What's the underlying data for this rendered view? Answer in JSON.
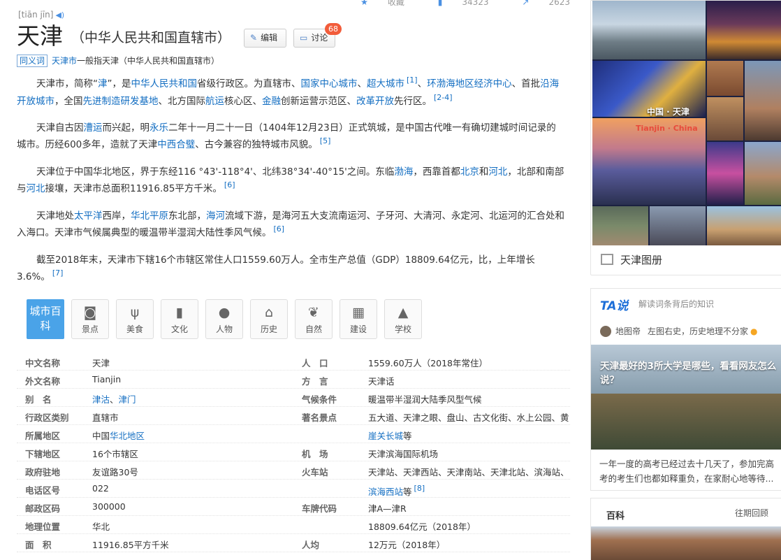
{
  "header": {
    "pinyin": "[tiān jīn]",
    "stats": {
      "collect": "收藏",
      "likes": "34323",
      "shares": "2623"
    }
  },
  "title": {
    "main": "天津",
    "sub": "（中华人民共和国直辖市）",
    "edit_label": "编辑",
    "discuss_label": "讨论",
    "discuss_count": "68"
  },
  "synonym": {
    "tag": "同义词",
    "term": "天津市",
    "text": "一般指天津（中华人民共和国直辖市）"
  },
  "paragraphs": {
    "p1": {
      "t1": "天津市，简称“",
      "l1": "津",
      "t2": "”，是",
      "l2": "中华人民共和国",
      "t3": "省级行政区。为直辖市、",
      "l3": "国家中心城市",
      "t4": "、",
      "l4": "超大城市",
      "ref1": "[1]",
      "t5": "、",
      "l5": "环渤海地区经济中心",
      "t6": "、首批",
      "l6": "沿海开放城市",
      "t7": "，全国",
      "l7": "先进制造研发基地",
      "t8": "、北方国际",
      "l8": "航运",
      "t9": "核心区、",
      "l9": "金融",
      "t10": "创新运营示范区、",
      "l10": "改革开放",
      "t11": "先行区。",
      "ref2": "[2-4]"
    },
    "p2": {
      "t1": "天津自古因",
      "l1": "漕运",
      "t2": "而兴起，明",
      "l2": "永乐",
      "t3": "二年十一月二十一日（1404年12月23日）正式筑城，是中国古代唯一有确切建城时间记录的城市。历经600多年，造就了天津",
      "l3": "中西合璧",
      "t4": "、古今兼容的独特城市风貌。",
      "ref": "[5]"
    },
    "p3": {
      "t1": "天津位于中国华北地区，界于东经116 °43'-118°4'、北纬38°34'-40°15'之间。东临",
      "l1": "渤海",
      "t2": "，西靠首都",
      "l2": "北京",
      "t3": "和",
      "l3": "河北",
      "t4": "，北部和南部与",
      "l4": "河北",
      "t5": "接壤，天津市总面积11916.85平方千米。",
      "ref": "[6]"
    },
    "p4": {
      "t1": "天津地处",
      "l1": "太平洋",
      "t2": "西岸，",
      "l2": "华北平原",
      "t3": "东北部，",
      "l3": "海河",
      "t4": "流域下游，是海河五大支流南运河、子牙河、大清河、永定河、北运河的汇合处和入海口。天津市气候属典型的暖温带半湿润大陆性季风气候。",
      "ref": "[6]"
    },
    "p5": {
      "t1": "截至2018年末，天津市下辖16个市辖区常住人口1559.60万人。全市生产总值（GDP）18809.64亿元，比，上年增长3.6%。",
      "ref": "[7]"
    }
  },
  "category_nav": {
    "first": "城市百科",
    "items": [
      {
        "label": "景点",
        "icon": "camera-icon"
      },
      {
        "label": "美食",
        "icon": "fork-knife-icon"
      },
      {
        "label": "文化",
        "icon": "book-icon"
      },
      {
        "label": "人物",
        "icon": "person-icon"
      },
      {
        "label": "历史",
        "icon": "temple-icon"
      },
      {
        "label": "自然",
        "icon": "leaf-icon"
      },
      {
        "label": "建设",
        "icon": "building-icon"
      },
      {
        "label": "学校",
        "icon": "graduation-cap-icon"
      }
    ]
  },
  "info": {
    "left": [
      {
        "k": "中文名称",
        "v": "天津"
      },
      {
        "k": "外文名称",
        "v": "Tianjin"
      },
      {
        "k": "别　名",
        "v1": "津沽",
        "sep": "、",
        "v2": "津门"
      },
      {
        "k": "行政区类别",
        "v": "直辖市"
      },
      {
        "k": "所属地区",
        "v_pre": "中国",
        "v_link": "华北地区"
      },
      {
        "k": "下辖地区",
        "v": "16个市辖区"
      },
      {
        "k": "政府驻地",
        "v": "友谊路30号"
      },
      {
        "k": "电话区号",
        "v": "022"
      },
      {
        "k": "邮政区码",
        "v": "300000"
      },
      {
        "k": "地理位置",
        "v": "华北"
      },
      {
        "k": "面　积",
        "v": "11916.85平方千米"
      }
    ],
    "right": [
      {
        "k": "人　口",
        "v": "1559.60万人（2018年常住）"
      },
      {
        "k": "方　言",
        "v": "天津话"
      },
      {
        "k": "气候条件",
        "v": "暖温带半湿润大陆季风型气候"
      },
      {
        "k": "著名景点",
        "v": "五大道、天津之眼、盘山、古文化街、水上公园、黄"
      },
      {
        "k": "",
        "v": "崖关长城",
        "v_tail": "等"
      },
      {
        "k": "机　场",
        "v": "天津滨海国际机场"
      },
      {
        "k": "火车站",
        "v": "天津站、天津西站、天津南站、天津北站、滨海站、"
      },
      {
        "k": "",
        "v": "滨海西站",
        "v_tail": "等",
        "ref": "[8]"
      },
      {
        "k": "车牌代码",
        "v": "津A—津R"
      },
      {
        "k": "",
        "v": "18809.64亿元（2018年）"
      },
      {
        "k": "人均",
        "v": "12万元（2018年）"
      }
    ]
  },
  "album": {
    "caption_cn": "中国 · 天津",
    "caption_en": "Tianjin · China",
    "footer": "天津图册"
  },
  "ta": {
    "logo": "TA说",
    "slogan": "解读词条背后的知识",
    "author": "地图帝",
    "author_desc": "左图右史，历史地理不分家",
    "img_title": "天津最好的3所大学是哪些，看看网友怎么说？",
    "desc": "一年一度的高考已经过去十几天了，参加完高考的考生们也都如释重负，在家耐心地等待..."
  },
  "baike": {
    "title": "百科",
    "link": "往期回顾"
  },
  "colors": {
    "link": "#136ec2",
    "badge": "#f25c3a",
    "cat_first": "#4aa3e8",
    "ta_logo": "#1d6fd8"
  }
}
